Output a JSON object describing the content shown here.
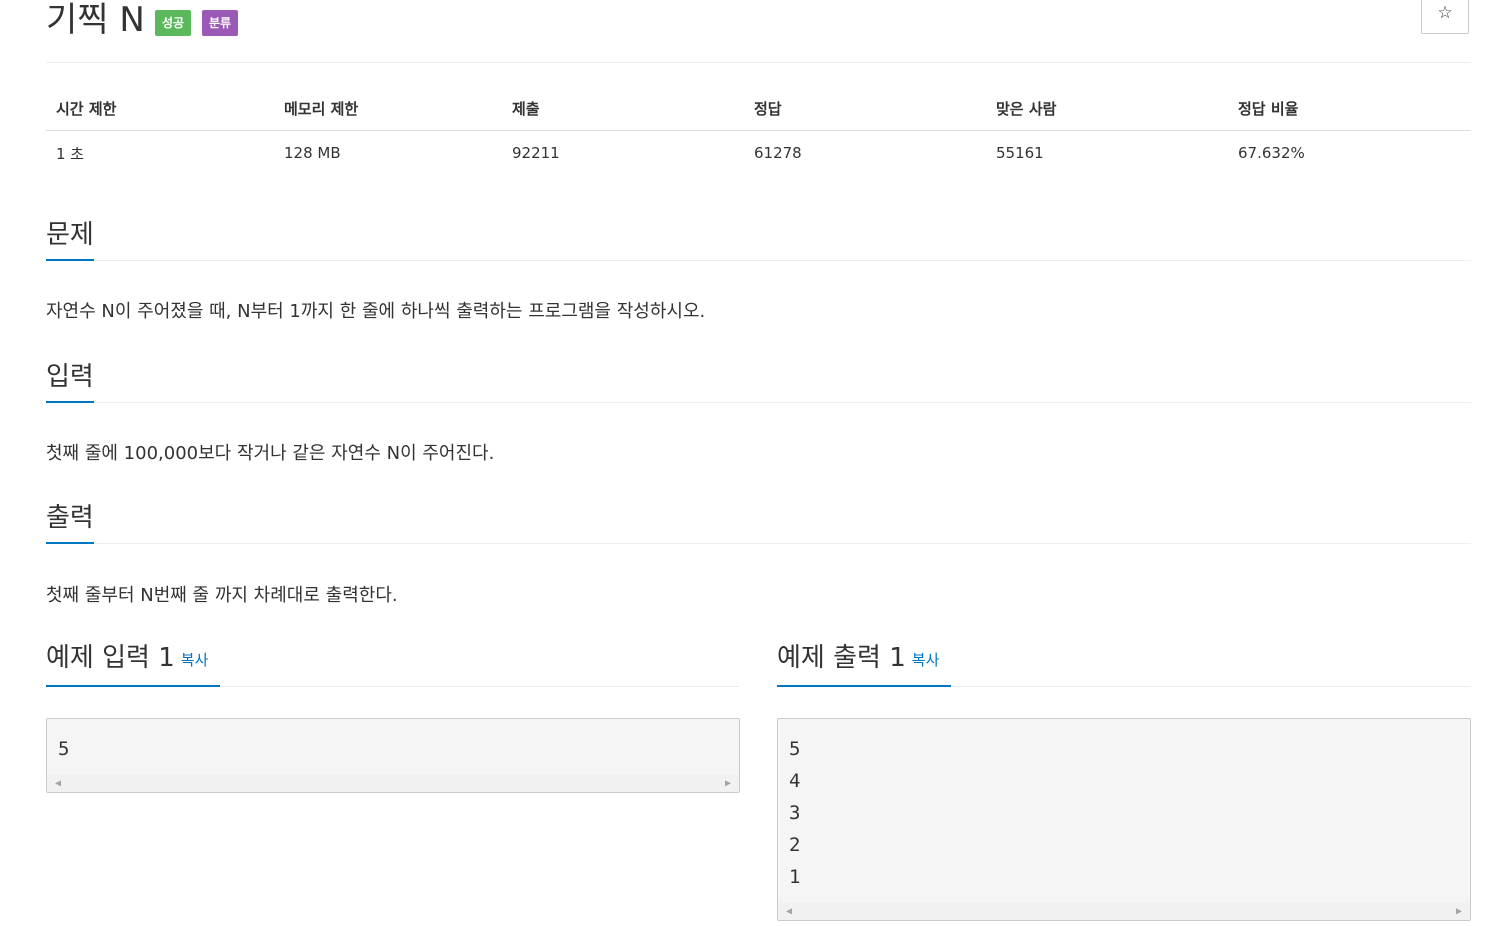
{
  "problem": {
    "title": "기찍 N",
    "badges": {
      "success": "성공",
      "category": "분류"
    },
    "star_icon": "☆"
  },
  "info_table": {
    "headers": [
      "시간 제한",
      "메모리 제한",
      "제출",
      "정답",
      "맞은 사람",
      "정답 비율"
    ],
    "values": [
      "1 초",
      "128 MB",
      "92211",
      "61278",
      "55161",
      "67.632%"
    ]
  },
  "sections": {
    "description": {
      "heading": "문제",
      "text": "자연수 N이 주어졌을 때, N부터 1까지 한 줄에 하나씩 출력하는 프로그램을 작성하시오."
    },
    "input": {
      "heading": "입력",
      "text": "첫째 줄에 100,000보다 작거나 같은 자연수 N이 주어진다."
    },
    "output": {
      "heading": "출력",
      "text": "첫째 줄부터 N번째 줄 까지 차례대로 출력한다."
    }
  },
  "samples": {
    "input": {
      "heading": "예제 입력 1",
      "copy_label": "복사",
      "content": "5"
    },
    "output": {
      "heading": "예제 출력 1",
      "copy_label": "복사",
      "content": "5\n4\n3\n2\n1"
    }
  },
  "icons": {
    "scroll_left": "◀",
    "scroll_right": "▶"
  },
  "colors": {
    "success_badge": "#5cb85c",
    "category_badge": "#9b59b6",
    "accent": "#0076c0"
  }
}
